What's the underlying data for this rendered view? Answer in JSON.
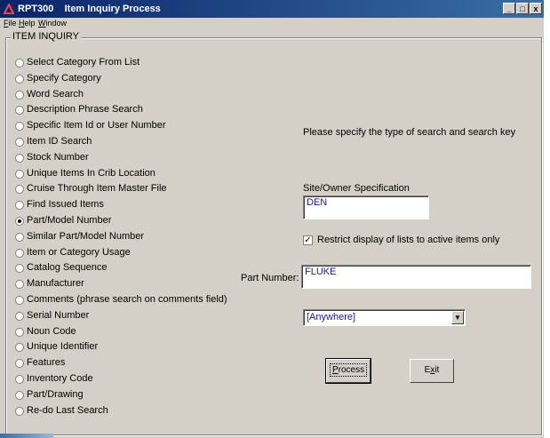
{
  "window": {
    "app_code": "RPT300",
    "title": "Item Inquiry Process",
    "minimize_glyph": "_",
    "maximize_glyph": "□",
    "close_glyph": "x"
  },
  "menu": [
    {
      "label": "File",
      "mnemonic": "F",
      "rest": "ile"
    },
    {
      "label": "Help",
      "mnemonic": "H",
      "rest": "elp"
    },
    {
      "label": "Window",
      "mnemonic": "W",
      "rest": "indow"
    }
  ],
  "group_title": "ITEM INQUIRY",
  "search_types": [
    {
      "label": "Select Category From List",
      "selected": false
    },
    {
      "label": "Specify Category",
      "selected": false
    },
    {
      "label": "Word Search",
      "selected": false
    },
    {
      "label": "Description Phrase Search",
      "selected": false
    },
    {
      "label": "Specific Item Id or User Number",
      "selected": false
    },
    {
      "label": "Item ID Search",
      "selected": false
    },
    {
      "label": "Stock Number",
      "selected": false
    },
    {
      "label": "Unique Items In Crib Location",
      "selected": false
    },
    {
      "label": "Cruise Through Item Master File",
      "selected": false
    },
    {
      "label": "Find Issued Items",
      "selected": false
    },
    {
      "label": "Part/Model Number",
      "selected": true
    },
    {
      "label": "Similar Part/Model Number",
      "selected": false
    },
    {
      "label": "Item or Category Usage",
      "selected": false
    },
    {
      "label": "Catalog Sequence",
      "selected": false
    },
    {
      "label": "Manufacturer",
      "selected": false
    },
    {
      "label": "Comments (phrase search on comments field)",
      "selected": false
    },
    {
      "label": "Serial Number",
      "selected": false
    },
    {
      "label": "Noun Code",
      "selected": false
    },
    {
      "label": "Unique Identifier",
      "selected": false
    },
    {
      "label": "Features",
      "selected": false
    },
    {
      "label": "Inventory Code",
      "selected": false
    },
    {
      "label": "Part/Drawing",
      "selected": false
    },
    {
      "label": "Re-do Last Search",
      "selected": false
    }
  ],
  "instruction": "Please specify the type of search and search key",
  "site_owner": {
    "label": "Site/Owner Specification",
    "value": "DEN"
  },
  "restrict_active": {
    "label": "Restrict display of lists to active items only",
    "checked": true,
    "check_glyph": "✓"
  },
  "part_number": {
    "label": "Part Number:",
    "value": "FLUKE"
  },
  "match_position": {
    "selected": "[Anywhere]",
    "arrow_glyph": "▼"
  },
  "buttons": {
    "process": {
      "label": "Process",
      "mnemonic": "P",
      "rest": "rocess"
    },
    "exit": {
      "label": "Exit",
      "pre": "E",
      "mnemonic": "x",
      "rest": "it"
    }
  }
}
